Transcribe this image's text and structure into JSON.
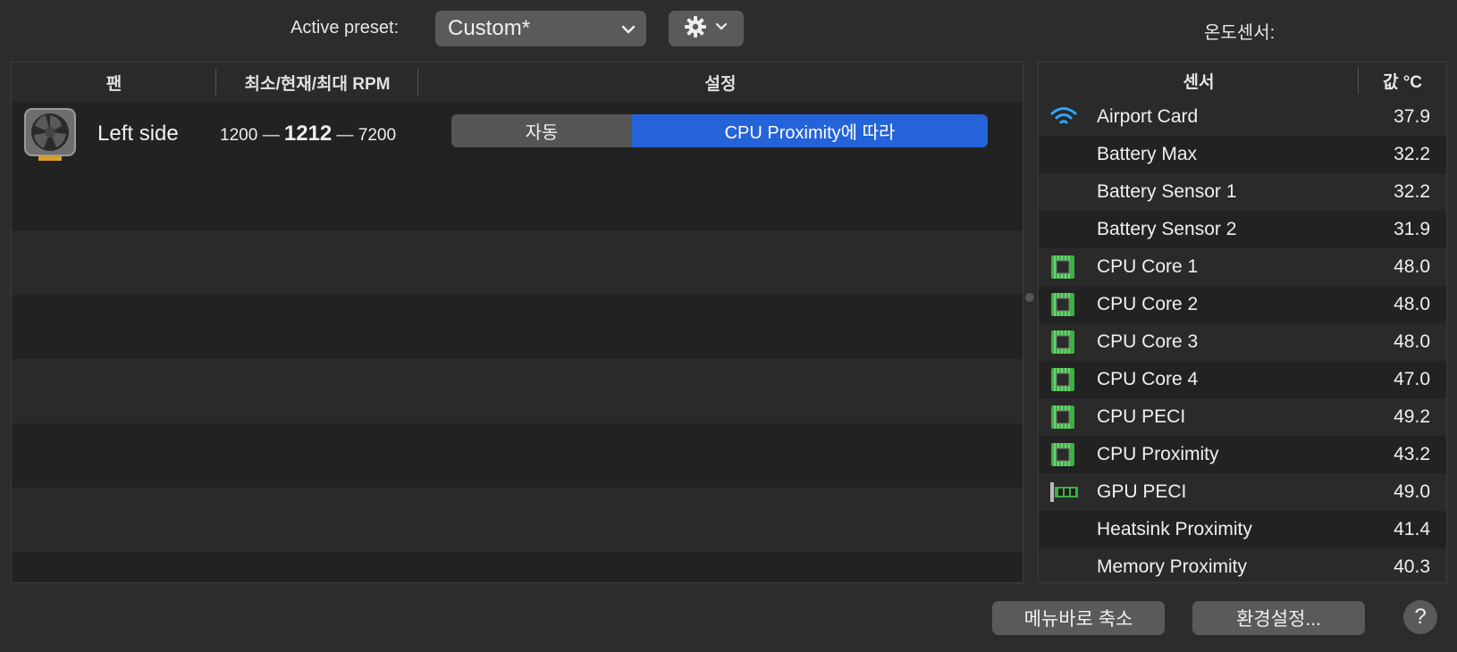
{
  "toolbar": {
    "preset_label": "Active preset:",
    "preset_value": "Custom*",
    "sensors_title": "온도센서:"
  },
  "fan_table": {
    "headers": {
      "fan": "팬",
      "rpm": "최소/현재/최대 RPM",
      "settings": "설정"
    },
    "fans": [
      {
        "name": "Left side",
        "min_rpm": "1200",
        "current_rpm": "1212",
        "max_rpm": "7200",
        "mode_auto_label": "자동",
        "mode_sensor_label": "CPU Proximity에 따라"
      }
    ]
  },
  "sensor_table": {
    "headers": {
      "sensor": "센서",
      "value": "값 °C"
    },
    "rows": [
      {
        "name": "Airport Card",
        "value": "37.9",
        "icon": "wifi-icon"
      },
      {
        "name": "Battery Max",
        "value": "32.2",
        "icon": ""
      },
      {
        "name": "Battery Sensor 1",
        "value": "32.2",
        "icon": ""
      },
      {
        "name": "Battery Sensor 2",
        "value": "31.9",
        "icon": ""
      },
      {
        "name": "CPU Core 1",
        "value": "48.0",
        "icon": "cpu-chip-icon"
      },
      {
        "name": "CPU Core 2",
        "value": "48.0",
        "icon": "cpu-chip-icon"
      },
      {
        "name": "CPU Core 3",
        "value": "48.0",
        "icon": "cpu-chip-icon"
      },
      {
        "name": "CPU Core 4",
        "value": "47.0",
        "icon": "cpu-chip-icon"
      },
      {
        "name": "CPU PECI",
        "value": "49.2",
        "icon": "cpu-chip-icon"
      },
      {
        "name": "CPU Proximity",
        "value": "43.2",
        "icon": "cpu-chip-icon"
      },
      {
        "name": "GPU PECI",
        "value": "49.0",
        "icon": "gpu-card-icon"
      },
      {
        "name": "Heatsink Proximity",
        "value": "41.4",
        "icon": ""
      },
      {
        "name": "Memory Proximity",
        "value": "40.3",
        "icon": ""
      }
    ]
  },
  "footer": {
    "collapse_label": "메뉴바로 축소",
    "prefs_label": "환경설정...",
    "help_label": "?"
  },
  "colors": {
    "accent": "#2563d8",
    "chip_green": "#3cb043"
  }
}
